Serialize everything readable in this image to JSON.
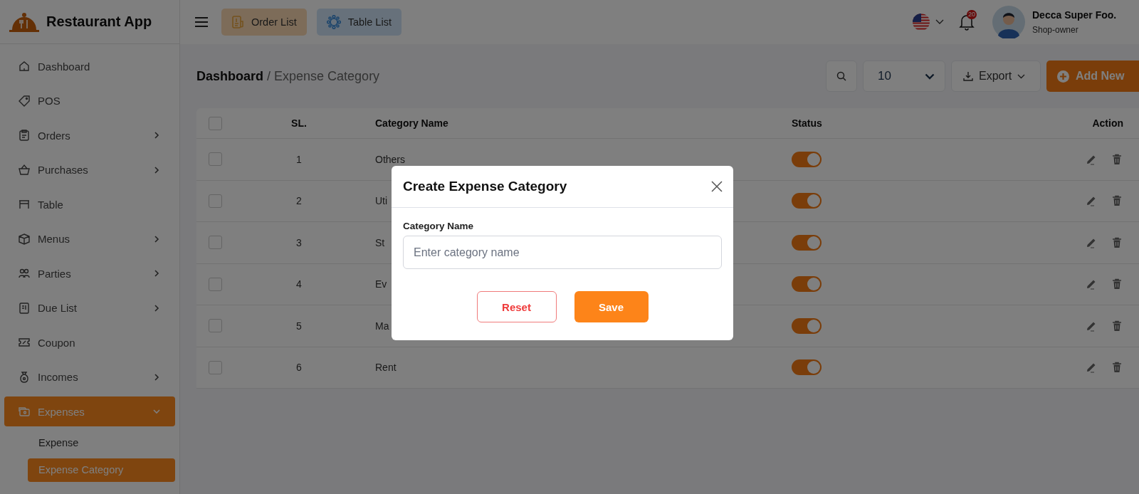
{
  "app": {
    "name": "Restaurant App"
  },
  "header": {
    "nav_buttons": [
      {
        "label": "Order List",
        "kind": "orders"
      },
      {
        "label": "Table List",
        "kind": "tables"
      }
    ],
    "notifications": {
      "count": "20"
    },
    "user": {
      "name": "Decca Super Foo.",
      "role": "Shop-owner"
    }
  },
  "sidebar": {
    "items": [
      {
        "label": "Dashboard",
        "selected": false
      },
      {
        "label": "POS",
        "selected": false
      },
      {
        "label": "Orders",
        "expanded": false,
        "selected": false
      },
      {
        "label": "Purchases",
        "expanded": false,
        "selected": false
      },
      {
        "label": "Table",
        "selected": false
      },
      {
        "label": "Menus",
        "expanded": false,
        "selected": false
      },
      {
        "label": "Parties",
        "expanded": false,
        "selected": false
      },
      {
        "label": "Due List",
        "expanded": false,
        "selected": false
      },
      {
        "label": "Coupon",
        "selected": false
      },
      {
        "label": "Incomes",
        "expanded": false,
        "selected": false
      },
      {
        "label": "Expenses",
        "expanded": true,
        "selected": true,
        "children": [
          {
            "label": "Expense",
            "selected": false
          },
          {
            "label": "Expense Category",
            "selected": true
          }
        ]
      }
    ]
  },
  "breadcrumb": {
    "parent": "Dashboard",
    "separator": "/",
    "current": "Expense Category"
  },
  "toolbar": {
    "page_size": "10",
    "export": "Export",
    "add": "Add New"
  },
  "table": {
    "all_checked": false,
    "columns": [
      "SL.",
      "Category Name",
      "Status",
      "Action"
    ],
    "rows": [
      {
        "sl": "1",
        "name": "Others",
        "checked": false,
        "on": true
      },
      {
        "sl": "2",
        "name": "Uti",
        "checked": false,
        "on": true
      },
      {
        "sl": "3",
        "name": "St",
        "checked": false,
        "on": true
      },
      {
        "sl": "4",
        "name": "Ev",
        "checked": false,
        "on": true
      },
      {
        "sl": "5",
        "name": "Ma",
        "checked": false,
        "on": true
      },
      {
        "sl": "6",
        "name": "Rent",
        "checked": false,
        "on": true
      }
    ]
  },
  "modal": {
    "title": "Create Expense Category",
    "field_label": "Category Name",
    "placeholder": "Enter category name",
    "buttons": [
      {
        "label": "Reset",
        "kind": "reset"
      },
      {
        "label": "Save",
        "kind": "primary"
      }
    ]
  }
}
